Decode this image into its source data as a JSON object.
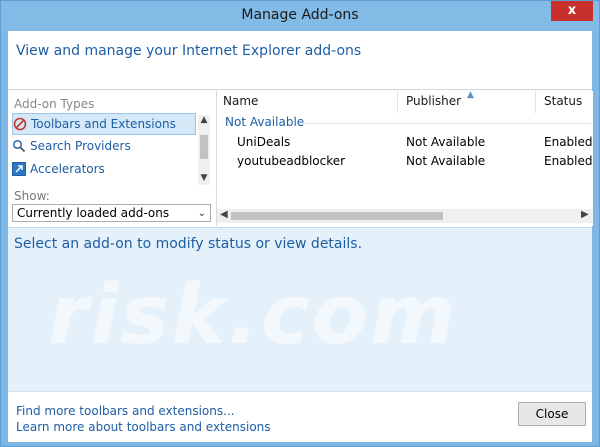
{
  "window": {
    "title": "Manage Add-ons",
    "close_glyph": "x"
  },
  "header": {
    "text": "View and manage your Internet Explorer add-ons"
  },
  "addon_types": {
    "label": "Add-on Types",
    "items": [
      {
        "label": "Toolbars and Extensions",
        "icon": "no-entry-gear-icon",
        "selected": true
      },
      {
        "label": "Search Providers",
        "icon": "magnifier-icon",
        "selected": false
      },
      {
        "label": "Accelerators",
        "icon": "accelerator-arrow-icon",
        "selected": false
      }
    ]
  },
  "show": {
    "label": "Show:",
    "selected": "Currently loaded add-ons"
  },
  "list": {
    "columns": [
      "Name",
      "Publisher",
      "Status"
    ],
    "group": "Not Available",
    "rows": [
      {
        "name": "UniDeals",
        "publisher": "Not Available",
        "status": "Enabled"
      },
      {
        "name": "youtubeadblocker",
        "publisher": "Not Available",
        "status": "Enabled"
      }
    ]
  },
  "details": {
    "text": "Select an add-on to modify status or view details.",
    "watermark": "risk.com"
  },
  "footer": {
    "link1": "Find more toolbars and extensions...",
    "link2": "Learn more about toolbars and extensions",
    "close_label": "Close"
  },
  "colors": {
    "accent": "#1d5ea5",
    "titlebar": "#82bbe6",
    "close": "#c7302b",
    "details_bg": "#e5f1fa"
  }
}
